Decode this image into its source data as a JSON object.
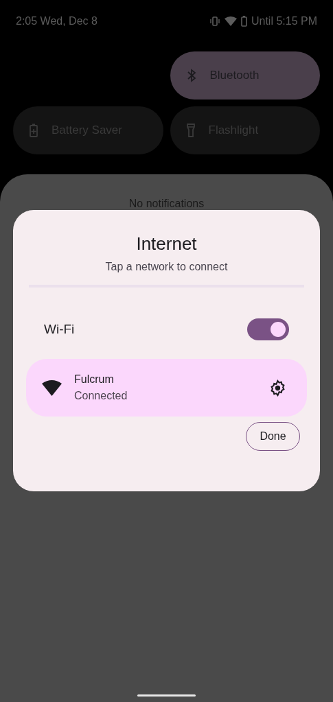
{
  "status_bar": {
    "time_date": "2:05 Wed, Dec 8",
    "battery_text": "Until 5:15 PM"
  },
  "tiles": [
    {
      "label": "Bluetooth",
      "kind": "bluetooth",
      "on": true
    },
    {
      "label": "Battery Saver",
      "kind": "battery",
      "on": false
    },
    {
      "label": "Flashlight",
      "kind": "flashlight",
      "on": false
    }
  ],
  "notifications": {
    "empty_text": "No notifications"
  },
  "dialog": {
    "title": "Internet",
    "subtitle": "Tap a network to connect",
    "wifi": {
      "label": "Wi-Fi",
      "on": true
    },
    "networks": [
      {
        "name": "Fulcrum",
        "status": "Connected",
        "selected": true
      }
    ],
    "done_button": "Done"
  }
}
